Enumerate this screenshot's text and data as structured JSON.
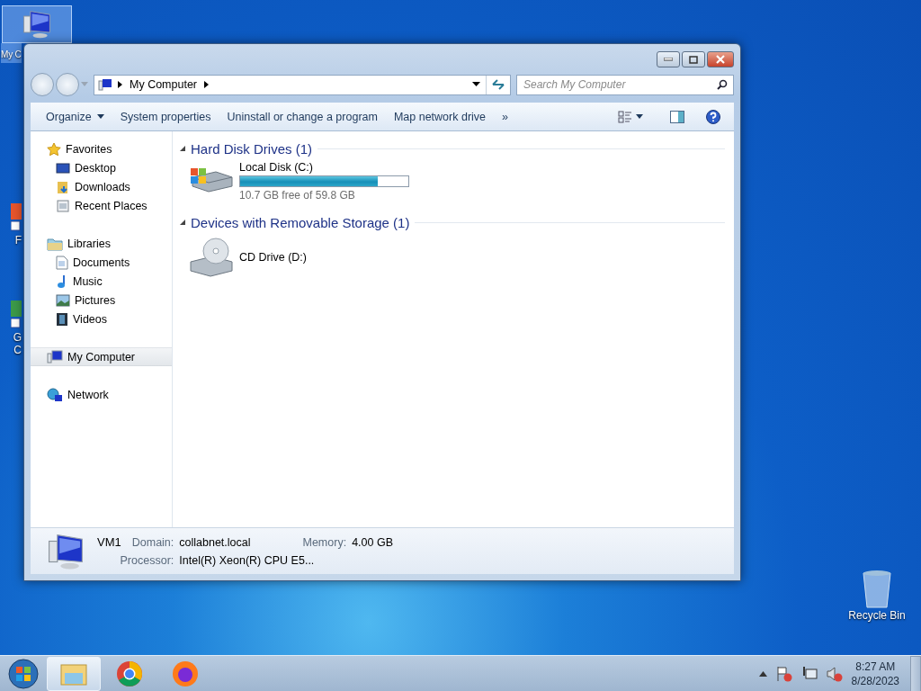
{
  "desktop_icons": [
    {
      "lines": [
        "My C"
      ],
      "selected": true
    },
    {
      "lines": [
        "F"
      ],
      "selected": false
    },
    {
      "lines": [
        "G",
        "C"
      ],
      "selected": false
    }
  ],
  "recycle_bin": {
    "lines": [
      "Recycle Bin"
    ],
    "selected": false
  },
  "window": {
    "address_path": [
      "My Computer"
    ],
    "search": {
      "placeholder": "Search My Computer"
    },
    "toolbar": [
      {
        "label": "Organize",
        "kind": "menu"
      },
      {
        "label": "System properties",
        "kind": "button"
      },
      {
        "label": "Uninstall or change a program",
        "kind": "button"
      },
      {
        "label": "Map network drive",
        "kind": "button"
      },
      {
        "label": "»",
        "kind": "button"
      }
    ],
    "sidebar": [
      {
        "label": "Favorites",
        "selected": false,
        "children": [
          {
            "label": "Desktop",
            "selected": false
          },
          {
            "label": "Downloads",
            "selected": false
          },
          {
            "label": "Recent Places",
            "selected": false
          }
        ]
      },
      {
        "label": "Libraries",
        "selected": false,
        "children": [
          {
            "label": "Documents",
            "selected": false
          },
          {
            "label": "Music",
            "selected": false
          },
          {
            "label": "Pictures",
            "selected": false
          },
          {
            "label": "Videos",
            "selected": false
          }
        ]
      },
      {
        "label": "My Computer",
        "selected": true
      },
      {
        "label": "Network",
        "selected": false
      }
    ],
    "groups": [
      {
        "title": "Hard Disk Drives (1)",
        "expanded": true,
        "items": [
          {
            "name": "Local Disk (C:)",
            "kind": "disk",
            "level": 0.82,
            "free": "10.7 GB free of 59.8 GB"
          }
        ]
      },
      {
        "title": "Devices with Removable Storage (1)",
        "expanded": true,
        "items": [
          {
            "name": "CD Drive (D:)",
            "kind": "cd"
          }
        ]
      }
    ],
    "details": {
      "name": "VM1",
      "fields": [
        {
          "label": "Domain:",
          "value": "collabnet.local"
        },
        {
          "label": "Memory:",
          "value": "4.00 GB"
        },
        {
          "label": "Processor:",
          "value": "Intel(R) Xeon(R) CPU E5..."
        }
      ]
    }
  },
  "taskbar": {
    "apps": [
      {
        "selected": true
      },
      {
        "selected": false
      },
      {
        "selected": false
      }
    ],
    "time": "8:27 AM",
    "date": "8/28/2023"
  }
}
